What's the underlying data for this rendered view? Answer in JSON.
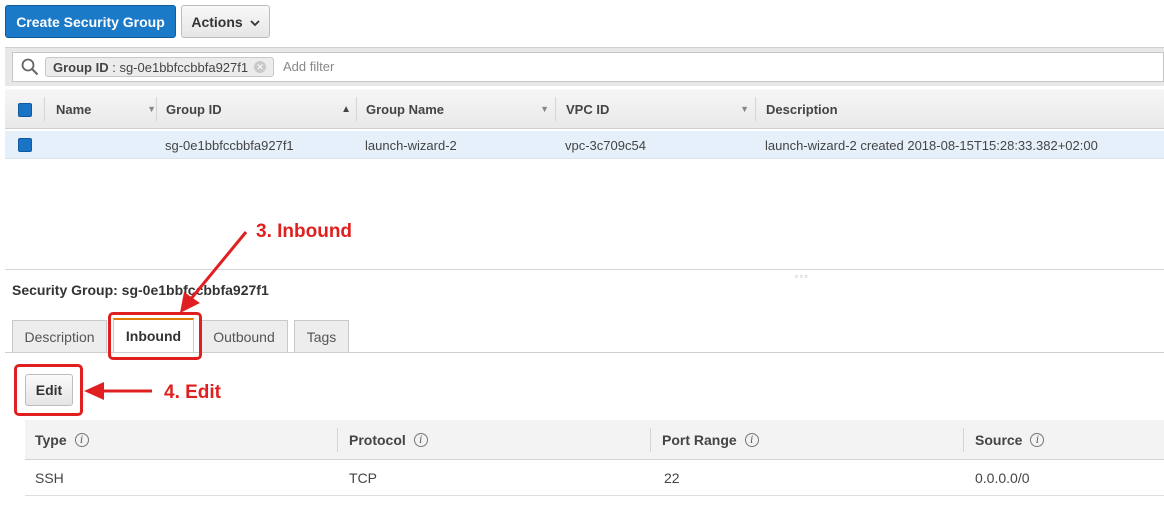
{
  "toolbar": {
    "create_label": "Create Security Group",
    "actions_label": "Actions"
  },
  "filter": {
    "chip_key": "Group ID",
    "chip_sep": " : ",
    "chip_value": "sg-0e1bbfccbbfa927f1",
    "placeholder": "Add filter"
  },
  "table": {
    "columns": [
      "Name",
      "Group ID",
      "Group Name",
      "VPC ID",
      "Description"
    ],
    "sorted_column": "Group ID",
    "rows": [
      {
        "name": "",
        "group_id": "sg-0e1bbfccbbfa927f1",
        "group_name": "launch-wizard-2",
        "vpc_id": "vpc-3c709c54",
        "description": "launch-wizard-2 created 2018-08-15T15:28:33.382+02:00",
        "selected": true
      }
    ]
  },
  "details": {
    "title": "Security Group: sg-0e1bbfccbbfa927f1",
    "tabs": [
      "Description",
      "Inbound",
      "Outbound",
      "Tags"
    ],
    "active_tab": "Inbound",
    "edit_label": "Edit"
  },
  "inbound": {
    "columns": [
      "Type",
      "Protocol",
      "Port Range",
      "Source"
    ],
    "rows": [
      {
        "type": "SSH",
        "protocol": "TCP",
        "port_range": "22",
        "source": "0.0.0.0/0"
      }
    ]
  },
  "annotations": {
    "step3": "3. Inbound",
    "step4": "4. Edit",
    "color": "#e02020"
  },
  "colors": {
    "primary_button": "#1a7ac8",
    "selected_row": "#e6f0fa",
    "active_tab_accent": "#e07a00"
  }
}
